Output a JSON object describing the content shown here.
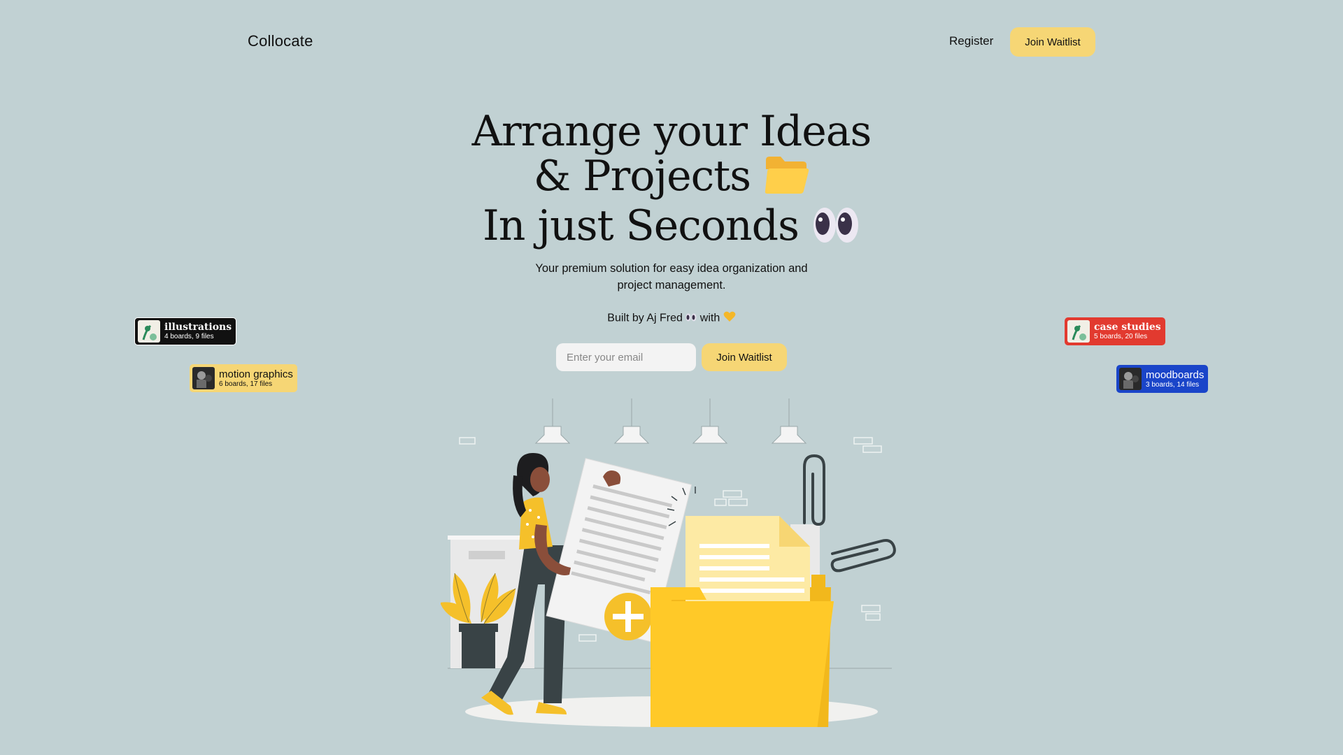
{
  "brand": "Collocate",
  "nav": {
    "register": "Register",
    "join": "Join Waitlist"
  },
  "hero": {
    "line1": "Arrange your Ideas",
    "line2": "& Projects",
    "line3": "In just Seconds",
    "line2_icon": "folder-emoji",
    "line3_icon": "eyes-emoji",
    "subtitle": "Your premium solution for easy idea organization and project management.",
    "built_by": "Built by Aj Fred",
    "built_with": "with",
    "built_icons": [
      "eyes-emoji",
      "yellow-heart-emoji"
    ]
  },
  "form": {
    "email_placeholder": "Enter your email",
    "join": "Join Waitlist"
  },
  "tags": [
    {
      "title": "illustrations",
      "boards": "4 boards,",
      "files": "9 files",
      "bg": "#111111",
      "fg": "#ffffff"
    },
    {
      "title": "motion graphics",
      "boards": "6 boards,",
      "files": "17 files",
      "bg": "#f6d675",
      "fg": "#111111"
    },
    {
      "title": "case studies",
      "boards": "5 boards,",
      "files": "20 files",
      "bg": "#e23a2f",
      "fg": "#ffffff"
    },
    {
      "title": "moodboards",
      "boards": "3 boards,",
      "files": "14 files",
      "bg": "#1a45c9",
      "fg": "#ffffff"
    }
  ],
  "colors": {
    "background": "#c1d1d3",
    "accent": "#f6d675",
    "folder": "#ffc928"
  }
}
